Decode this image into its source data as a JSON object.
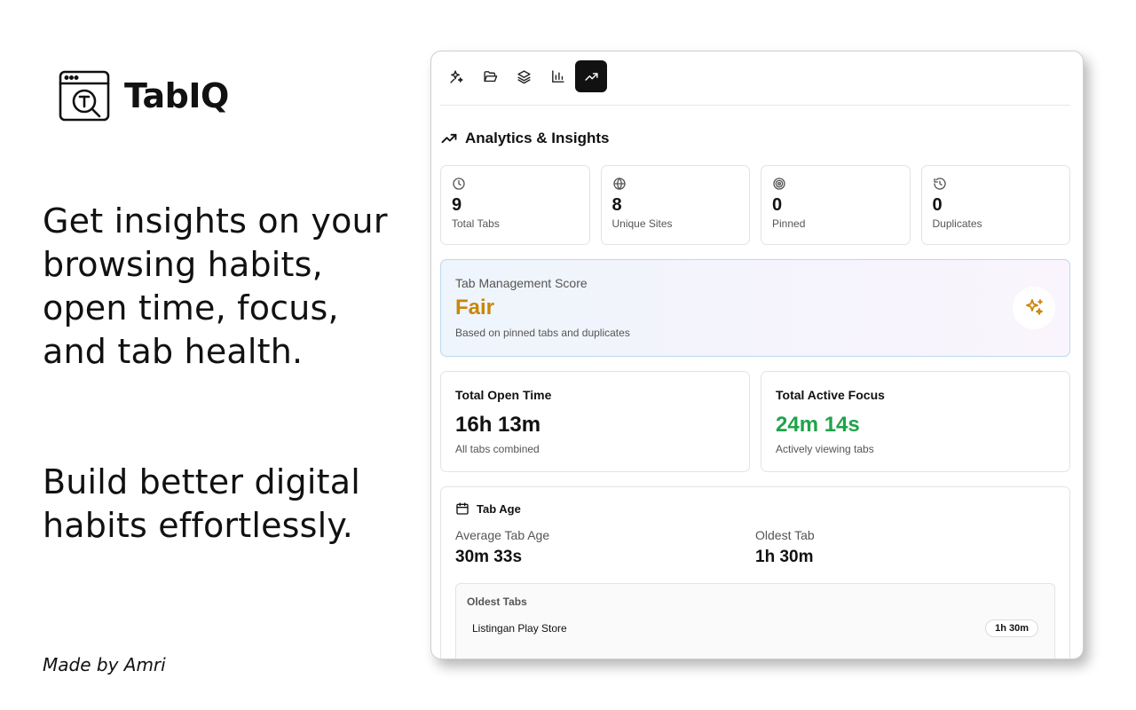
{
  "brand": {
    "name": "TabIQ",
    "logo_icon": "browser-search-icon"
  },
  "tagline": {
    "line1": "Get insights on your browsing habits, open time, focus, and tab health.",
    "line2": "Build better digital habits effortlessly."
  },
  "footer": {
    "made_by": "Made by Amri"
  },
  "toolbar": {
    "buttons": [
      {
        "icon": "sparkles-icon",
        "active": false
      },
      {
        "icon": "folder-open-icon",
        "active": false
      },
      {
        "icon": "layers-icon",
        "active": false
      },
      {
        "icon": "bar-chart-icon",
        "active": false
      },
      {
        "icon": "trending-up-icon",
        "active": true
      }
    ]
  },
  "analytics": {
    "title": "Analytics & Insights",
    "stats": [
      {
        "icon": "clock-icon",
        "value": "9",
        "label": "Total Tabs"
      },
      {
        "icon": "globe-icon",
        "value": "8",
        "label": "Unique Sites"
      },
      {
        "icon": "target-icon",
        "value": "0",
        "label": "Pinned"
      },
      {
        "icon": "history-icon",
        "value": "0",
        "label": "Duplicates"
      }
    ],
    "score": {
      "title": "Tab Management Score",
      "value": "Fair",
      "subtitle": "Based on pinned tabs and duplicates",
      "color": "#c9860a"
    },
    "open_time": {
      "title": "Total Open Time",
      "value": "16h 13m",
      "subtitle": "All tabs combined"
    },
    "active_focus": {
      "title": "Total Active Focus",
      "value": "24m 14s",
      "subtitle": "Actively viewing tabs",
      "color": "#1fa34a"
    },
    "tab_age": {
      "title": "Tab Age",
      "average_label": "Average Tab Age",
      "average_value": "30m 33s",
      "oldest_label": "Oldest Tab",
      "oldest_value": "1h 30m",
      "oldest_tabs_title": "Oldest Tabs",
      "oldest_tabs": [
        {
          "name": "Listingan Play Store",
          "age": "1h 30m"
        }
      ]
    }
  }
}
